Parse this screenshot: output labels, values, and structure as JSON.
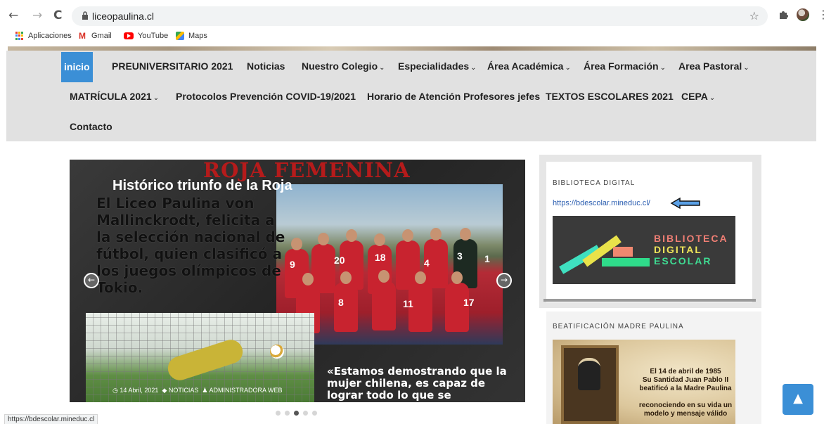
{
  "browser": {
    "back_icon": "←",
    "forward_icon": "→",
    "reload_icon": "C",
    "url": "liceopaulina.cl",
    "star_icon": "☆",
    "menu_icon": "⋮"
  },
  "bookmarks": [
    {
      "label": "Aplicaciones",
      "icon": "apps-icon"
    },
    {
      "label": "Gmail",
      "icon": "gmail-icon"
    },
    {
      "label": "YouTube",
      "icon": "youtube-icon"
    },
    {
      "label": "Maps",
      "icon": "maps-icon"
    }
  ],
  "nav": {
    "row1": [
      "inicio",
      "PREUNIVERSITARIO 2021",
      "Noticias",
      "Nuestro Colegio",
      "Especialidades",
      "Área Académica",
      "Área Formación",
      "Area Pastoral"
    ],
    "row2": [
      "MATRÍCULA 2021",
      "Protocolos Prevención COVID-19/2021",
      "Horario de Atención Profesores jefes",
      "TEXTOS ESCOLARES 2021",
      "CEPA"
    ],
    "row3": [
      "Contacto"
    ],
    "caret": "⌄",
    "active_color": "#3b8fd6"
  },
  "slider": {
    "banner": "ROJA FEMENINA",
    "title": "Histórico triunfo de la Roja",
    "text": "El Liceo Paulina von Mallinckrodt, felicita a la selección nacional de fútbol, quien clasificó a los juegos olímpicos de Tokio.",
    "quote": "«Estamos demostrando que la mujer chilena, es capaz de lograr todo lo que se",
    "meta_date": "14 Abril, 2021",
    "meta_category": "NOTICIAS",
    "meta_author": "ADMINISTRADORA WEB",
    "prev_icon": "←",
    "next_icon": "→",
    "jersey_numbers": [
      "9",
      "20",
      "18",
      "4",
      "3",
      "1",
      "8",
      "11",
      "17"
    ],
    "dots_total": 5,
    "dots_active": 3
  },
  "sidebar": {
    "widget1_title": "BIBLIOTECA DIGITAL",
    "widget1_link": "https://bdescolar.mineduc.cl/",
    "banner_lines": [
      "BIBLIOTECA",
      "DIGITAL",
      "ESCOLAR"
    ],
    "widget2_title": "BEATIFICACIÓN MADRE PAULINA",
    "beat_lines": [
      "El 14 de abril de 1985",
      "Su Santidad Juan Pablo II",
      "beatificó a la Madre Paulina",
      "reconociendo en su vida un",
      "modelo y mensaje válido"
    ]
  },
  "scroll_top_icon": "▲",
  "status_bar": "https://bdescolar.mineduc.cl"
}
